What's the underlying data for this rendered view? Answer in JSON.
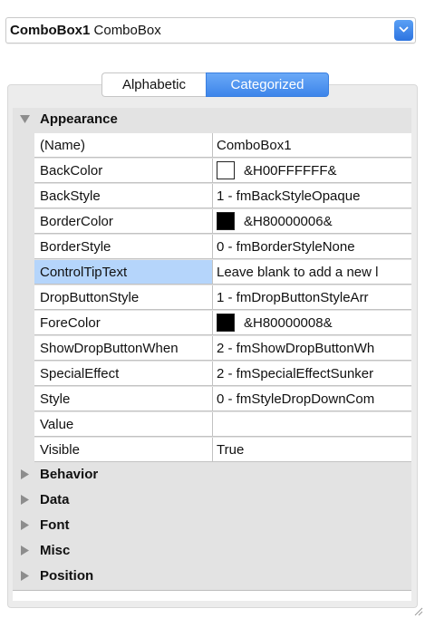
{
  "object_selector": {
    "name": "ComboBox1",
    "type": "ComboBox"
  },
  "tabs": [
    {
      "label": "Alphabetic",
      "selected": false
    },
    {
      "label": "Categorized",
      "selected": true
    }
  ],
  "categories": {
    "appearance": {
      "label": "Appearance",
      "expanded": true,
      "properties": [
        {
          "name": "(Name)",
          "value": "ComboBox1"
        },
        {
          "name": "BackColor",
          "value": "&H00FFFFFF&",
          "swatch": "#ffffff"
        },
        {
          "name": "BackStyle",
          "value": "1 - fmBackStyleOpaque"
        },
        {
          "name": "BorderColor",
          "value": "&H80000006&",
          "swatch": "#000000"
        },
        {
          "name": "BorderStyle",
          "value": "0 - fmBorderStyleNone"
        },
        {
          "name": "ControlTipText",
          "value": "Leave blank to add a new l",
          "selected": true
        },
        {
          "name": "DropButtonStyle",
          "value": "1 - fmDropButtonStyleArr"
        },
        {
          "name": "ForeColor",
          "value": "&H80000008&",
          "swatch": "#000000"
        },
        {
          "name": "ShowDropButtonWhen",
          "value": "2 - fmShowDropButtonWh"
        },
        {
          "name": "SpecialEffect",
          "value": "2 - fmSpecialEffectSunker"
        },
        {
          "name": "Style",
          "value": "0 - fmStyleDropDownCom"
        },
        {
          "name": "Value",
          "value": ""
        },
        {
          "name": "Visible",
          "value": "True"
        }
      ]
    },
    "collapsed": [
      {
        "label": "Behavior"
      },
      {
        "label": "Data"
      },
      {
        "label": "Font"
      },
      {
        "label": "Misc"
      },
      {
        "label": "Position"
      }
    ]
  },
  "colors": {
    "accent": "#3d85ea",
    "selection": "#b5d5fb",
    "category_bg": "#e3e3e3"
  },
  "icons": {
    "dropdown": "chevron-down-icon",
    "expanded": "triangle-down-icon",
    "collapsed": "triangle-right-icon"
  }
}
